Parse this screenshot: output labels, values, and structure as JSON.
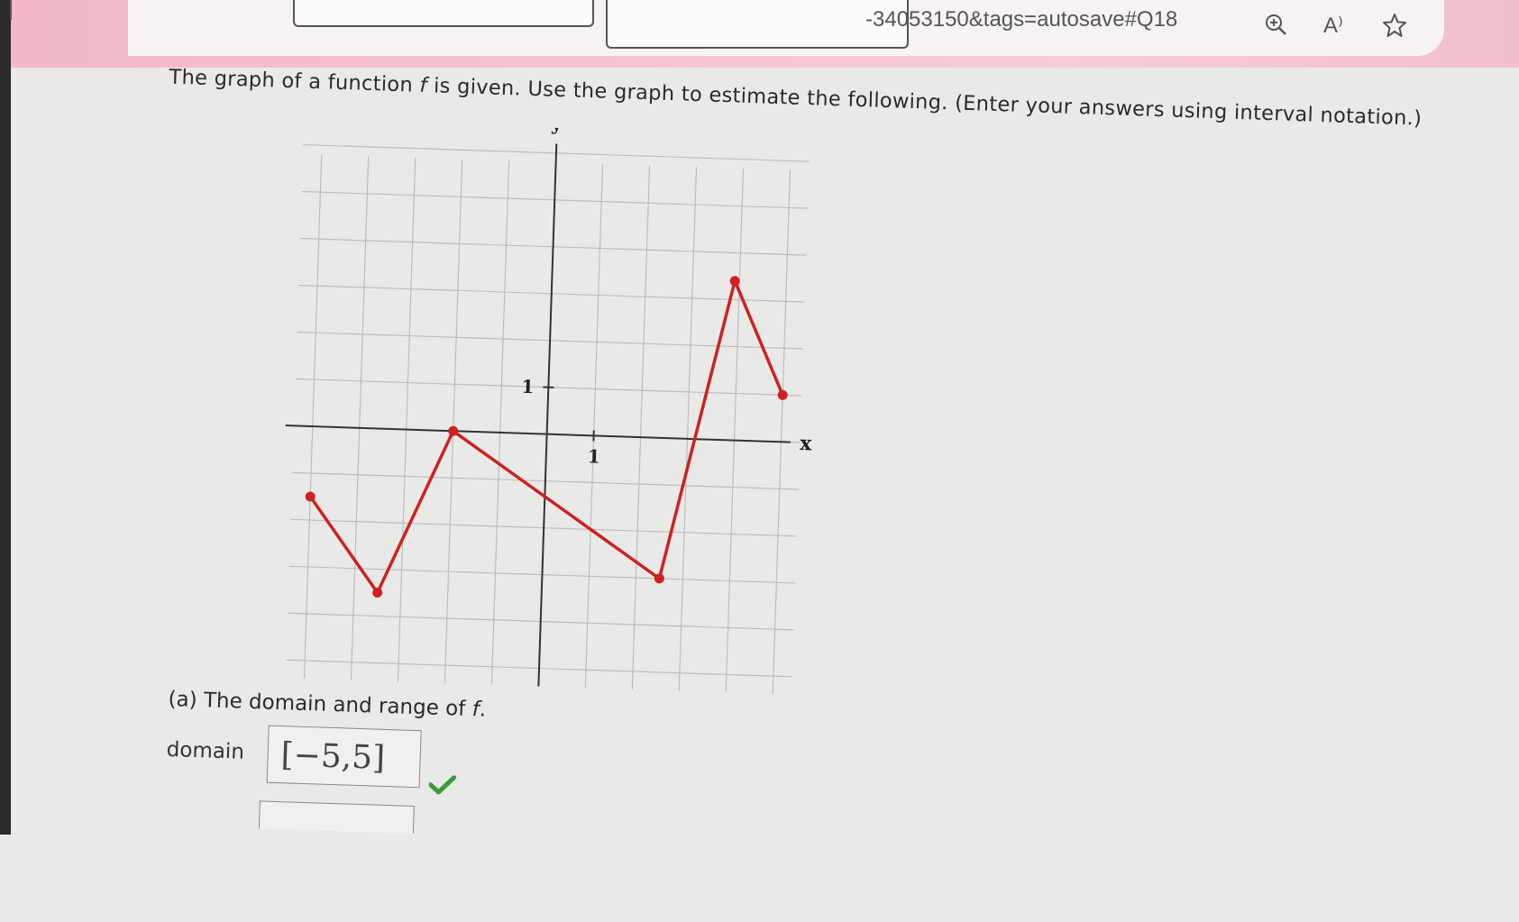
{
  "browser": {
    "url_fragment": "-34053150&tags=autosave#Q18",
    "toolbar_icons": [
      "zoom-in-icon",
      "read-aloud-icon",
      "favorite-star-icon",
      "split-screen-icon"
    ],
    "read_aloud_glyph": "A⁾",
    "chrome_color": "#f3b7c6"
  },
  "question": {
    "prefix": "The graph of a function ",
    "fvar": "f",
    "suffix": " is given. Use the graph to estimate the following. (Enter your answers using interval notation.)"
  },
  "graph": {
    "x_label": "x",
    "y_label": "y",
    "x_tick_label": "1",
    "y_tick_label": "1",
    "line_color": "#cc2222",
    "points": [
      [
        -5,
        -1.5
      ],
      [
        -3.5,
        -3.5
      ],
      [
        -2,
        0
      ],
      [
        2.5,
        -3
      ],
      [
        3.9,
        3.4
      ],
      [
        5,
        1
      ]
    ]
  },
  "part_a": {
    "text": "(a) The domain and range of ",
    "fvar": "f",
    "end": "."
  },
  "domain": {
    "label": "domain",
    "value": "[−5,5]",
    "status": "correct"
  }
}
